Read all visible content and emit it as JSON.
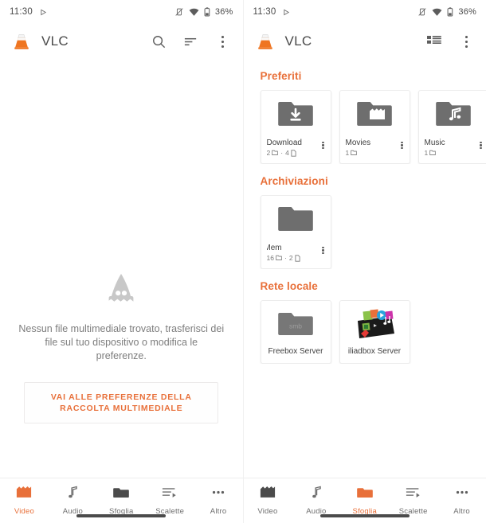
{
  "status_bar": {
    "time": "11:30",
    "battery_percent": "36%",
    "icons": [
      "play-triangle-icon",
      "vibrate-off-icon",
      "wifi-icon",
      "battery-icon"
    ]
  },
  "colors": {
    "accent": "#e8703a",
    "text_primary": "#4a4a4a",
    "text_secondary": "#7d7d7d",
    "folder_grey": "#6e6e6e",
    "card_border": "#ececec"
  },
  "left_screen": {
    "app_bar": {
      "title": "VLC",
      "logo": "vlc-cone-logo",
      "actions": [
        {
          "name": "search-button",
          "icon": "search-icon"
        },
        {
          "name": "sort-button",
          "icon": "sort-icon"
        },
        {
          "name": "overflow-menu-button",
          "icon": "more-vertical-icon"
        }
      ]
    },
    "empty_state": {
      "icon": "vlc-cone-placeholder-icon",
      "message": "Nessun file multimediale trovato, trasferisci dei file sul tuo dispositivo o modifica le preferenze.",
      "button_label": "VAI ALLE PREFERENZE DELLA RACCOLTA MULTIMEDIALE"
    },
    "bottom_nav": {
      "active": "Video",
      "items": [
        {
          "label": "Video",
          "icon": "video-clapper-icon"
        },
        {
          "label": "Audio",
          "icon": "music-note-icon"
        },
        {
          "label": "Sfoglia",
          "icon": "folder-icon"
        },
        {
          "label": "Scalette",
          "icon": "playlist-icon"
        },
        {
          "label": "Altro",
          "icon": "more-horizontal-icon"
        }
      ]
    }
  },
  "right_screen": {
    "app_bar": {
      "title": "VLC",
      "logo": "vlc-cone-logo",
      "actions": [
        {
          "name": "view-mode-button",
          "icon": "grid-view-icon"
        },
        {
          "name": "overflow-menu-button",
          "icon": "more-vertical-icon"
        }
      ]
    },
    "sections": [
      {
        "title": "Preferiti",
        "cards": [
          {
            "name": "Download",
            "folders": "2",
            "files": "4",
            "icon": "folder-download-icon"
          },
          {
            "name": "Movies",
            "folders": "1",
            "files": "",
            "icon": "folder-movies-icon"
          },
          {
            "name": "Music",
            "folders": "1",
            "files": "",
            "icon": "folder-music-icon"
          },
          {
            "name": "",
            "folders": "",
            "files": "",
            "icon": "folder-icon"
          }
        ]
      },
      {
        "title": "Archiviazioni",
        "cards": [
          {
            "name": "na        Mem",
            "folders": "16",
            "files": "2",
            "icon": "folder-icon"
          }
        ]
      },
      {
        "title": "Rete locale",
        "network_cards": [
          {
            "name": "Freebox Server",
            "icon": "smb-folder-icon",
            "badge": "smb"
          },
          {
            "name": "iliadbox Server",
            "icon": "media-server-thumbnail",
            "badge": ""
          }
        ]
      }
    ],
    "bottom_nav": {
      "active": "Sfoglia",
      "items": [
        {
          "label": "Video",
          "icon": "video-clapper-icon"
        },
        {
          "label": "Audio",
          "icon": "music-note-icon"
        },
        {
          "label": "Sfoglia",
          "icon": "folder-icon"
        },
        {
          "label": "Scalette",
          "icon": "playlist-icon"
        },
        {
          "label": "Altro",
          "icon": "more-horizontal-icon"
        }
      ]
    }
  }
}
